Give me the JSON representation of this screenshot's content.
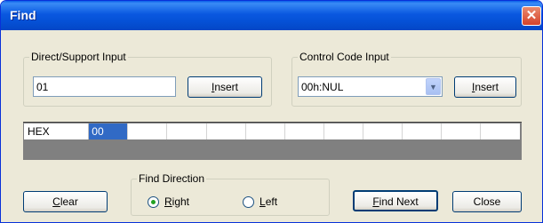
{
  "title": "Find",
  "close_glyph": "✕",
  "direct": {
    "label": "Direct/Support Input",
    "value": "01",
    "insert_label": "Insert",
    "insert_mnemonic": "I",
    "insert_rest": "nsert"
  },
  "control": {
    "label": "Control Code Input",
    "selected": "00h:NUL",
    "insert_mnemonic": "I",
    "insert_rest": "nsert"
  },
  "hex": {
    "header": "HEX",
    "cells": [
      "00",
      "",
      "",
      "",
      "",
      "",
      "",
      "",
      "",
      "",
      ""
    ]
  },
  "find_direction": {
    "label": "Find Direction",
    "right_mnemonic": "R",
    "right_rest": "ight",
    "left_mnemonic": "L",
    "left_rest": "eft",
    "selected": "Right"
  },
  "buttons": {
    "clear_mnemonic": "C",
    "clear_rest": "lear",
    "find_next_mnemonic": "F",
    "find_next_rest": "ind Next",
    "close": "Close"
  }
}
